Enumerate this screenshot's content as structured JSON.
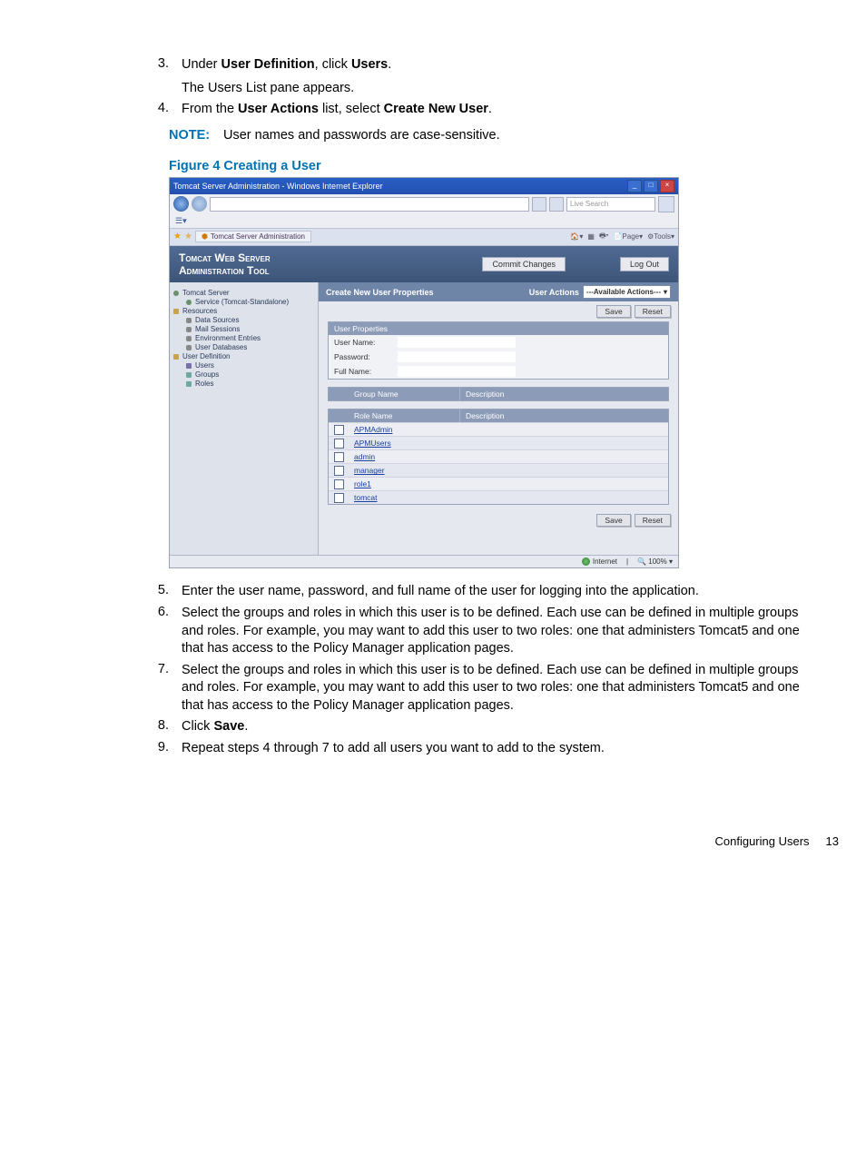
{
  "steps_top": [
    {
      "num": "3.",
      "html": "Under <b>User Definition</b>, click <b>Users</b>.",
      "sub": "The Users List pane appears."
    },
    {
      "num": "4.",
      "html": "From the <b>User Actions</b> list, select <b>Create New User</b>."
    }
  ],
  "note": {
    "label": "NOTE:",
    "text": "User names and passwords are case-sensitive."
  },
  "figure_caption": "Figure 4 Creating a User",
  "ie": {
    "title": "Tomcat Server Administration - Windows Internet Explorer",
    "search_placeholder": "Live Search",
    "tab_label": "Tomcat Server Administration",
    "tools": [
      "Page",
      "Tools"
    ]
  },
  "app": {
    "title_line1": "Tomcat Web Server",
    "title_line2": "Administration Tool",
    "commit": "Commit Changes",
    "logout": "Log Out"
  },
  "tree": [
    {
      "label": "Tomcat Server",
      "cls": "",
      "dot": "wheel"
    },
    {
      "label": "Service (Tomcat-Standalone)",
      "cls": "ind1",
      "dot": "wheel"
    },
    {
      "label": "Resources",
      "cls": "",
      "dot": "folder"
    },
    {
      "label": "Data Sources",
      "cls": "ind1",
      "dot": "db"
    },
    {
      "label": "Mail Sessions",
      "cls": "ind1",
      "dot": "db"
    },
    {
      "label": "Environment Entries",
      "cls": "ind1",
      "dot": "db"
    },
    {
      "label": "User Databases",
      "cls": "ind1",
      "dot": "db"
    },
    {
      "label": "User Definition",
      "cls": "",
      "dot": "folder"
    },
    {
      "label": "Users",
      "cls": "ind1",
      "dot": "user"
    },
    {
      "label": "Groups",
      "cls": "ind1",
      "dot": "grp"
    },
    {
      "label": "Roles",
      "cls": "ind1",
      "dot": "grp"
    }
  ],
  "panel": {
    "title": "Create New User Properties",
    "user_actions": "User Actions",
    "ua_placeholder": "---Available Actions---",
    "save": "Save",
    "reset": "Reset",
    "props_head": "User Properties",
    "fields": {
      "uname": "User Name:",
      "pwd": "Password:",
      "fname": "Full Name:"
    },
    "group_head": {
      "c2": "Group Name",
      "c3": "Description"
    },
    "role_head": {
      "c2": "Role Name",
      "c3": "Description"
    },
    "roles": [
      {
        "name": "APMAdmin"
      },
      {
        "name": "APMUsers"
      },
      {
        "name": "admin"
      },
      {
        "name": "manager"
      },
      {
        "name": "role1"
      },
      {
        "name": "tomcat"
      }
    ]
  },
  "status": {
    "zone": "Internet",
    "zoom": "100%"
  },
  "steps_bottom": [
    {
      "num": "5.",
      "text": "Enter the user name, password, and full name of the user for logging into the application."
    },
    {
      "num": "6.",
      "text": "Select the groups and roles in which this user is to be defined. Each use can be defined in multiple groups and roles. For example, you may want to add this user to two roles: one that administers Tomcat5 and one that has access to the Policy Manager application pages."
    },
    {
      "num": "7.",
      "text": "Select the groups and roles in which this user is to be defined. Each use can be defined in multiple groups and roles. For example, you may want to add this user to two roles: one that administers Tomcat5 and one that has access to the Policy Manager application pages."
    },
    {
      "num": "8.",
      "html": "Click <b>Save</b>."
    },
    {
      "num": "9.",
      "text": "Repeat steps 4 through 7 to add all users you want to add to the system."
    }
  ],
  "footer": {
    "section": "Configuring Users",
    "page": "13"
  }
}
